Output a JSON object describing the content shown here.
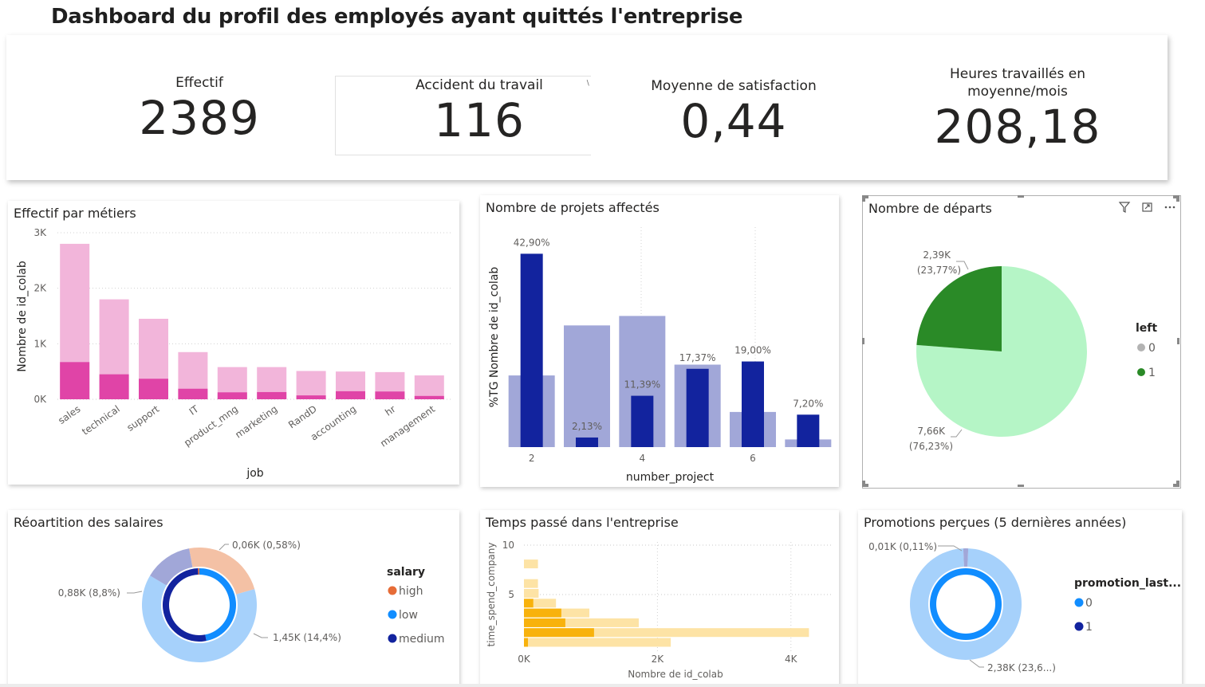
{
  "title": "Dashboard du profil des employés ayant quittés l'entreprise",
  "kpis": [
    {
      "label": "Effectif",
      "value": "2389"
    },
    {
      "label": "Accident du travail",
      "value": "116"
    },
    {
      "label": "Moyenne de satisfaction",
      "value": "0,44"
    },
    {
      "label": "Heures travaillés en moyenne/mois",
      "value": "208,18"
    }
  ],
  "chart_data": [
    {
      "id": "jobs",
      "type": "bar",
      "title": "Effectif par métiers",
      "xlabel": "job",
      "ylabel": "Nombre de id_colab",
      "ylim": [
        0,
        3000
      ],
      "yticks": [
        "0K",
        "1K",
        "2K",
        "3K"
      ],
      "categories": [
        "sales",
        "technical",
        "support",
        "IT",
        "product_mng",
        "marketing",
        "RandD",
        "accounting",
        "hr",
        "management"
      ],
      "series": [
        {
          "values": [
            2800,
            1800,
            1450,
            850,
            580,
            580,
            510,
            500,
            490,
            430
          ],
          "color": "#f2b5da"
        },
        {
          "values": [
            670,
            450,
            370,
            190,
            125,
            130,
            70,
            145,
            140,
            60
          ],
          "color": "#e044a7"
        }
      ]
    },
    {
      "id": "projects",
      "type": "bar",
      "title": "Nombre de projets affectés",
      "xlabel": "number_project",
      "ylabel": "%TG Nombre de id_colab",
      "categories": [
        2,
        3,
        4,
        5,
        6,
        7
      ],
      "xticks": [
        "2",
        "4",
        "6"
      ],
      "series": [
        {
          "values": [
            15.9,
            27.0,
            29.1,
            18.3,
            7.8,
            1.7
          ],
          "color": "#a1a7d8"
        },
        {
          "values": [
            42.9,
            2.13,
            11.39,
            17.37,
            19.0,
            7.2
          ],
          "color": "#12239e",
          "labels": [
            "42,90%",
            "2,13%",
            "11,39%",
            "17,37%",
            "19,00%",
            "7,20%"
          ]
        }
      ]
    },
    {
      "id": "departs",
      "type": "pie",
      "title": "Nombre de départs",
      "legend_title": "left",
      "slices": [
        {
          "name": "0",
          "value": 7660,
          "label_value": "7,66K",
          "label_pct": "(76,23%)",
          "color": "#b5f5c6",
          "legend_color": "#b3b3b3"
        },
        {
          "name": "1",
          "value": 2390,
          "label_value": "2,39K",
          "label_pct": "(23,77%)",
          "color": "#2a8a27",
          "legend_color": "#2a8a27"
        }
      ]
    },
    {
      "id": "salaires",
      "type": "pie",
      "title": "Réoartition des salaires",
      "legend_title": "salary",
      "outer": [
        {
          "name": "high",
          "pct": 0.58,
          "label": "0,06K (0,58%)",
          "color": "#f4c1a5"
        },
        {
          "name": "low",
          "pct": 14.4,
          "label": "1,45K (14,4%)",
          "color": "#a6d1fb"
        },
        {
          "name": "medium",
          "pct": 8.8,
          "label": "0,88K (8,8%)",
          "color": "#a1a7d8"
        }
      ],
      "inner": [
        {
          "name": "high",
          "pct": 0.58,
          "color": "#e66c37"
        },
        {
          "name": "low",
          "pct": 14.4,
          "color": "#118dff"
        },
        {
          "name": "medium",
          "pct": 8.8,
          "color": "#12239e"
        }
      ],
      "legend": [
        {
          "name": "high",
          "color": "#e66c37"
        },
        {
          "name": "low",
          "color": "#118dff"
        },
        {
          "name": "medium",
          "color": "#12239e"
        }
      ]
    },
    {
      "id": "temps",
      "type": "bar",
      "title": "Temps passé dans l'entreprise",
      "xlabel": "Nombre de id_colab",
      "ylabel": "time_spend_company",
      "xticks": [
        "0K",
        "2K",
        "4K"
      ],
      "yticks": [
        "5",
        "10"
      ],
      "xlim": [
        0,
        4600
      ],
      "categories": [
        2,
        3,
        4,
        5,
        6,
        7,
        8,
        10
      ],
      "series": [
        {
          "values": [
            2200,
            4270,
            1720,
            980,
            480,
            220,
            210,
            210
          ],
          "color": "#fde3a5"
        },
        {
          "values": [
            60,
            1050,
            620,
            560,
            140,
            0,
            0,
            0
          ],
          "color": "#f8b20c"
        }
      ]
    },
    {
      "id": "promotions",
      "type": "pie",
      "title": "Promotions perçues (5 dernières années)",
      "legend_title": "promotion_last...",
      "outer": [
        {
          "name": "0",
          "pct": 99.1,
          "label": "2,38K (23,6...)",
          "color": "#a6d1fb"
        },
        {
          "name": "1",
          "pct": 0.9,
          "label": "0,01K (0,11%)",
          "color": "#a1a7d8"
        }
      ],
      "inner": [
        {
          "name": "0",
          "pct": 100,
          "color": "#118dff"
        }
      ],
      "legend": [
        {
          "name": "0",
          "color": "#118dff"
        },
        {
          "name": "1",
          "color": "#12239e"
        }
      ]
    }
  ]
}
